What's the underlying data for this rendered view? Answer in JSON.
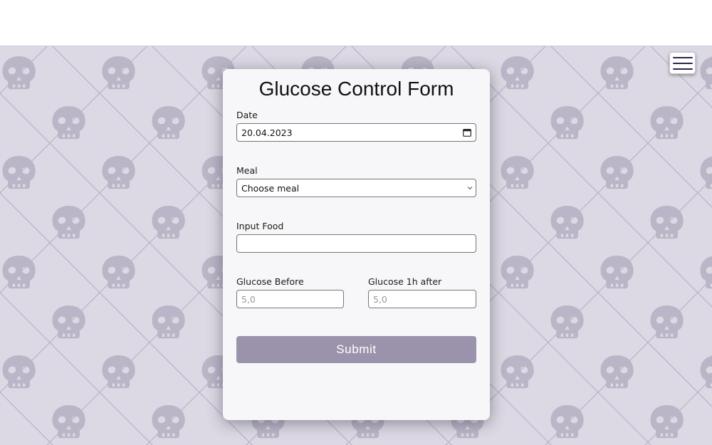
{
  "form": {
    "title": "Glucose Control Form",
    "date": {
      "label": "Date",
      "value": "20.04.2023"
    },
    "meal": {
      "label": "Meal",
      "selected": "Choose meal"
    },
    "food": {
      "label": "Input Food",
      "value": ""
    },
    "glucose_before": {
      "label": "Glucose Before",
      "placeholder": "5,0"
    },
    "glucose_after": {
      "label": "Glucose 1h after",
      "placeholder": "5,0"
    },
    "submit_label": "Submit"
  },
  "icons": {
    "menu": "hamburger-menu-icon",
    "calendar": "calendar-icon",
    "select": "chevron-down-icon",
    "background": "skull-icon"
  },
  "colors": {
    "background": "#dcd9e4",
    "pattern": "#bbb6c7",
    "card": "#f7f7f9",
    "submit": "#9b93ab",
    "menu_bars": "#2b2650"
  }
}
